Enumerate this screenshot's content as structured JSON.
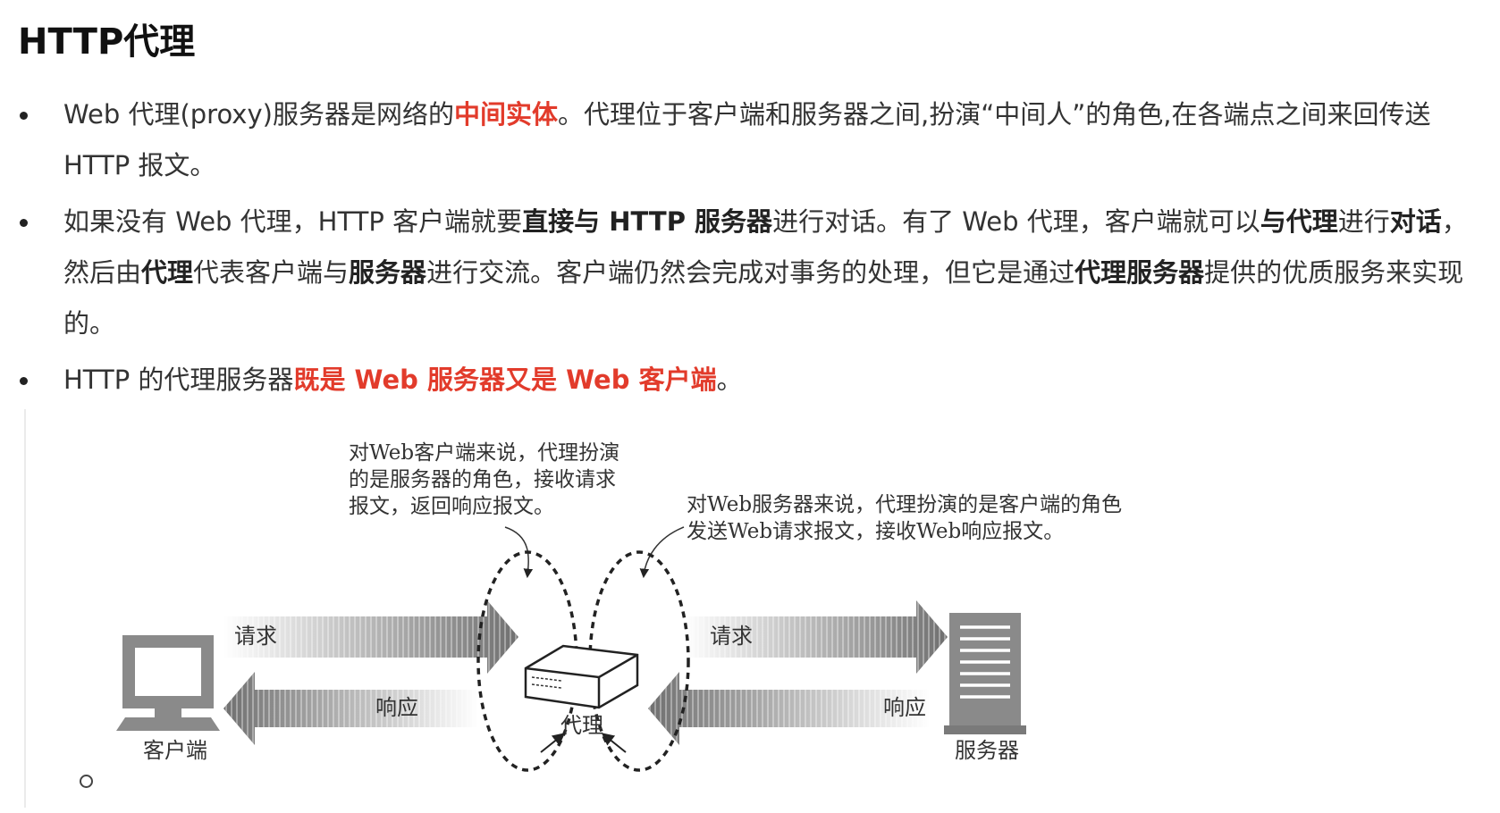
{
  "title": "HTTP代理",
  "bullets": [
    {
      "runs": [
        {
          "text": "Web 代理(proxy)服务器是网络的"
        },
        {
          "text": "中间实体",
          "style": "red"
        },
        {
          "text": "。代理位于客户端和服务器之间,扮演“中间人”的角色,在各端点之间来回传送 HTTP 报文。"
        }
      ]
    },
    {
      "runs": [
        {
          "text": "如果没有 Web 代理，HTTP 客户端就要"
        },
        {
          "text": "直接与 HTTP 服务器",
          "style": "bold"
        },
        {
          "text": "进行对话。有了 Web 代理，客户端就可以"
        },
        {
          "text": "与代理",
          "style": "bold"
        },
        {
          "text": "进行"
        },
        {
          "text": "对话",
          "style": "bold"
        },
        {
          "text": "，然后由"
        },
        {
          "text": "代理",
          "style": "bold"
        },
        {
          "text": "代表客户端与"
        },
        {
          "text": "服务器",
          "style": "bold"
        },
        {
          "text": "进行交流。客户端仍然会完成对事务的处理，但它是通过"
        },
        {
          "text": "代理服务器",
          "style": "bold"
        },
        {
          "text": "提供的优质服务来实现的。"
        }
      ]
    },
    {
      "runs": [
        {
          "text": "HTTP 的代理服务器"
        },
        {
          "text": "既是 Web 服务器又是 Web 客户端",
          "style": "red"
        },
        {
          "text": "。"
        }
      ]
    }
  ],
  "diagram": {
    "left_note": [
      "对Web客户端来说，代理扮演",
      "的是服务器的角色，接收请求",
      "报文，返回响应报文。"
    ],
    "right_note": [
      "对Web服务器来说，代理扮演的是客户端的角色",
      "发送Web请求报文，接收Web响应报文。"
    ],
    "client_label": "客户端",
    "proxy_label": "代理",
    "server_label": "服务器",
    "request_left": "请求",
    "response_left": "响应",
    "request_right": "请求",
    "response_right": "响应"
  }
}
